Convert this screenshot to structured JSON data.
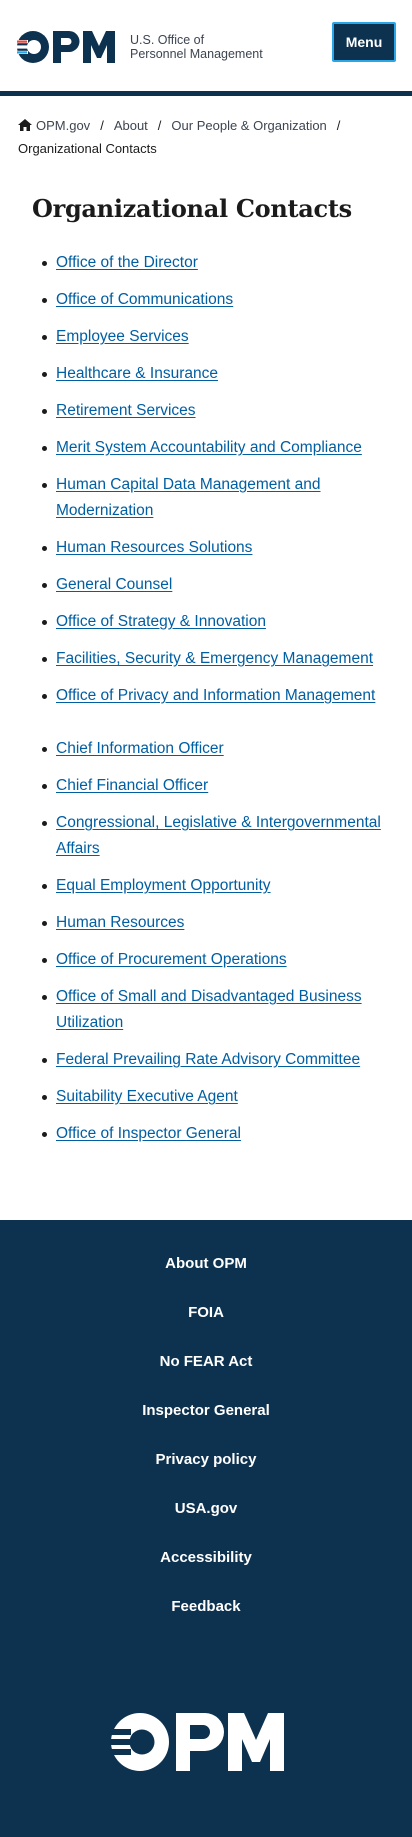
{
  "header": {
    "logo_wordmark": "OPM",
    "agency_line1": "U.S. Office of",
    "agency_line2": "Personnel Management",
    "menu_label": "Menu"
  },
  "breadcrumb": {
    "home": "OPM.gov",
    "items": [
      "About",
      "Our People & Organization"
    ],
    "separator": "/",
    "current": "Organizational Contacts"
  },
  "main": {
    "title": "Organizational Contacts",
    "links": [
      "Office of the Director",
      "Office of Communications",
      "Employee Services",
      "Healthcare & Insurance",
      "Retirement Services",
      "Merit System Accountability and Compliance",
      "Human Capital Data Management and Modernization",
      "Human Resources Solutions",
      "General Counsel",
      "Office of Strategy & Innovation",
      "Facilities, Security & Emergency Management",
      "Office of Privacy and Information Management",
      "Chief Information Officer",
      "Chief Financial Officer",
      "Congressional, Legislative & Intergovernmental Affairs",
      "Equal Employment Opportunity",
      "Human Resources",
      "Office of Procurement Operations",
      "Office of Small and Disadvantaged Business Utilization",
      "Federal Prevailing Rate Advisory Committee",
      "Suitability Executive Agent",
      "Office of Inspector General"
    ]
  },
  "footer": {
    "links": [
      "About OPM",
      "FOIA",
      "No FEAR Act",
      "Inspector General",
      "Privacy policy",
      "USA.gov",
      "Accessibility",
      "Feedback"
    ],
    "logo_wordmark": "OPM"
  },
  "colors": {
    "navy": "#0d3250",
    "link": "#005ea2",
    "logo_red": "#e8483f",
    "logo_blue": "#2aa6e6"
  }
}
